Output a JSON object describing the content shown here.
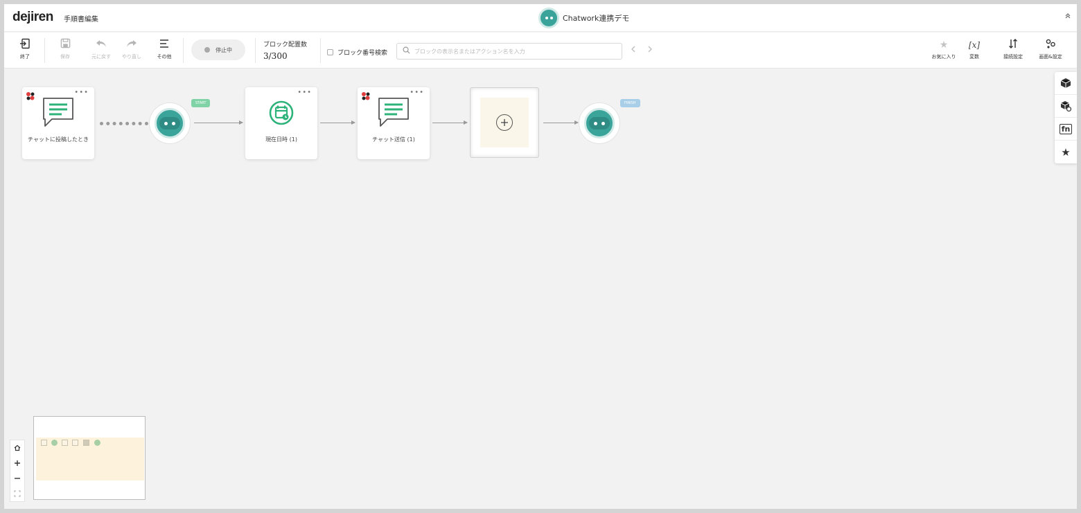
{
  "header": {
    "logo": "dejiren",
    "page_title": "手順書編集",
    "app_title": "Chatwork連携デモ",
    "collapse_icon": "double-chevron-up-icon"
  },
  "toolbar": {
    "exit_label": "終了",
    "save_label": "保存",
    "undo_label": "元に戻す",
    "redo_label": "やり直し",
    "other_label": "その他",
    "status_label": "停止中",
    "block_count_label": "ブロック配置数",
    "block_count_value": "3/300",
    "block_number_search_label": "ブロック番号検索",
    "search_placeholder": "ブロックの表示名またはアクション名を入力",
    "favorites_label": "お気に入り",
    "variables_label": "変数",
    "connection_settings_label": "接続設定",
    "screen_settings_label": "画面&設定"
  },
  "flow": {
    "trigger_label": "チャットに投稿したとき",
    "start_tag": "START",
    "datetime_label": "現在日時 (1)",
    "chat_send_label": "チャット送信 (1)",
    "finish_tag": "FINISH",
    "menu_glyph": "•••"
  },
  "colors": {
    "robot_teal": "#3aa39a",
    "icon_green": "#2db37a",
    "start_tag": "#7fd3a6",
    "finish_tag": "#a9cfe8"
  }
}
